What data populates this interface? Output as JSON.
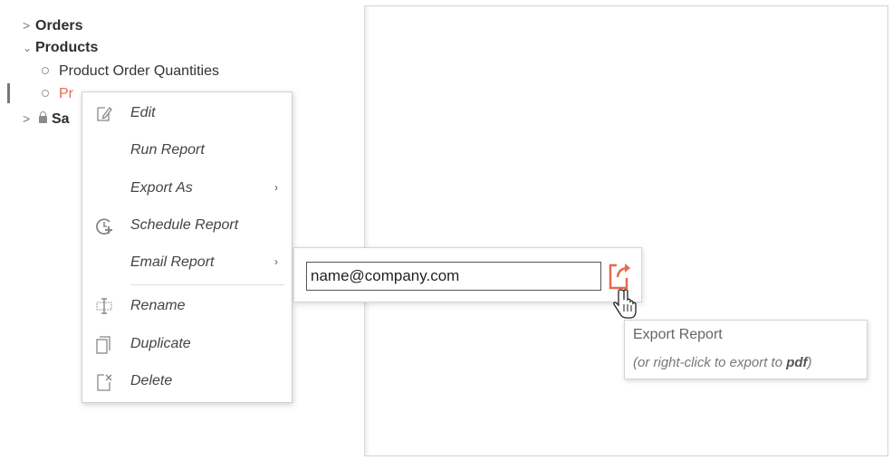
{
  "tree": {
    "items": [
      {
        "label": "Orders",
        "state": "collapsed"
      },
      {
        "label": "Products",
        "state": "expanded"
      },
      {
        "label": "Product Order Quantities"
      },
      {
        "label": "Products By Category",
        "active": true
      },
      {
        "label": "Sales",
        "locked": true
      }
    ],
    "visible_fragments": {
      "active_prefix": "Pr",
      "locked_prefix": "Sa"
    }
  },
  "context_menu": {
    "items": [
      {
        "label": "Edit",
        "icon": "edit-icon"
      },
      {
        "label": "Run Report"
      },
      {
        "label": "Export As",
        "submenu": true
      },
      {
        "label": "Schedule Report",
        "icon": "schedule-clock-add-icon"
      },
      {
        "label": "Email Report",
        "submenu": true
      },
      {
        "label": "Rename",
        "icon": "rename-cursor-icon"
      },
      {
        "label": "Duplicate",
        "icon": "duplicate-icon"
      },
      {
        "label": "Delete",
        "icon": "delete-icon"
      }
    ]
  },
  "email_popup": {
    "value": "name@company.com",
    "export_icon": "export-share-icon"
  },
  "tooltip": {
    "title": "Export Report",
    "subtitle_prefix": "(or right-click to export to ",
    "subtitle_bold": "pdf",
    "subtitle_suffix": ")"
  },
  "colors": {
    "accent": "#e8694d",
    "menu_text": "#444444",
    "border": "#d4d4d4"
  }
}
